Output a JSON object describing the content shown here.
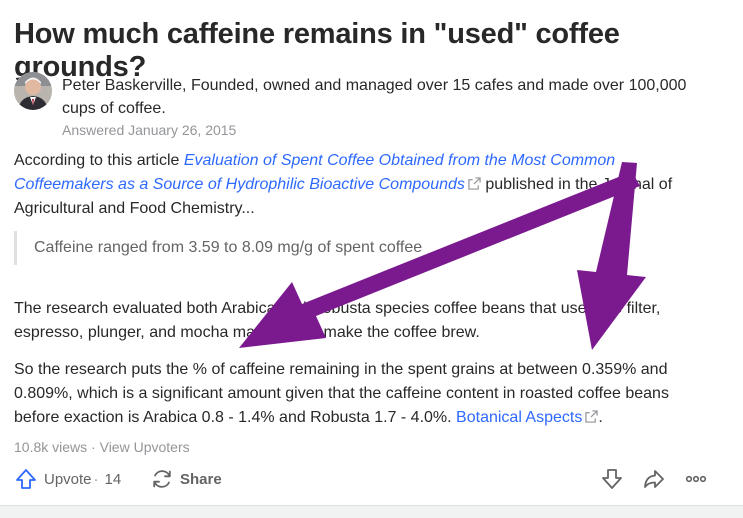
{
  "question": {
    "title": "How much caffeine remains in \"used\" coffee grounds?"
  },
  "author": {
    "name_and_credential": "Peter Baskerville, Founded, owned and managed over 15 cafes and made over 100,000 cups of coffee.",
    "answered": "Answered January 26, 2015"
  },
  "answer": {
    "intro_prefix": "According to this article ",
    "article_link": "Evaluation of Spent Coffee Obtained from the Most Common Coffeemakers as a Source of Hydrophilic Bioactive Compounds",
    "intro_suffix": " published in the Journal of Agricultural and Food Chemistry...",
    "quote": "Caffeine ranged from 3.59 to 8.09 mg/g of spent coffee",
    "para2": "The research evaluated both Arabica and Robusta species coffee beans that used the filter, espresso, plunger, and mocha machines to make the coffee brew.",
    "para3": "So the research puts the % of caffeine remaining in the spent grains at between 0.359% and 0.809%, which is a significant amount given that the caffeine content in roasted coffee beans before exaction is Arabica 0.8 - 1.4% and Robusta 1.7 - 4.0%. ",
    "para3_link": "Botanical Aspects",
    "para3_end": "."
  },
  "stats": {
    "views": "10.8k views",
    "separator": " · ",
    "view_upvoters": "View Upvoters"
  },
  "actions": {
    "upvote_label": "Upvote",
    "dot": " · ",
    "upvote_count": "14",
    "share_label": "Share"
  },
  "colors": {
    "link": "#2e69ff",
    "arrow": "#7b1a8f",
    "text": "#282829",
    "muted": "#939598"
  },
  "icons": [
    "external-link-icon",
    "upvote-arrow-icon",
    "share-icon",
    "downvote-arrow-icon",
    "forward-icon",
    "more-icon"
  ]
}
